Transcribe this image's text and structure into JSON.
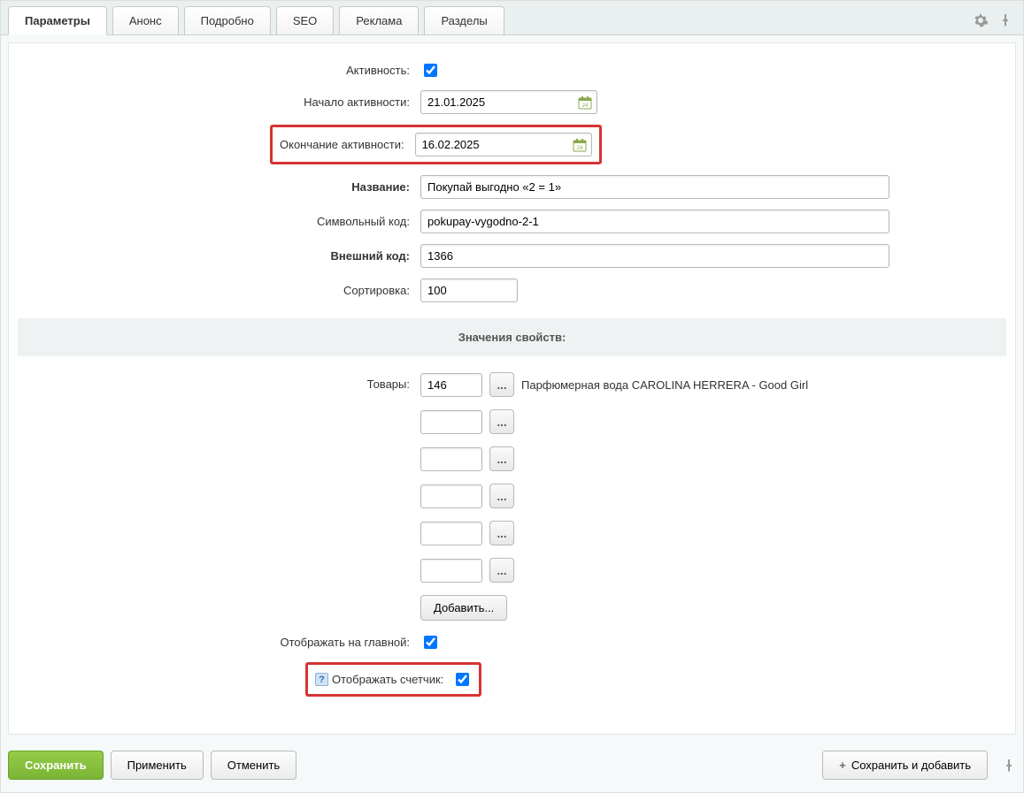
{
  "tabs": {
    "items": [
      "Параметры",
      "Анонс",
      "Подробно",
      "SEO",
      "Реклама",
      "Разделы"
    ],
    "activeIndex": 0
  },
  "form": {
    "activity_label": "Активность:",
    "activity_checked": true,
    "start_label": "Начало активности:",
    "start_value": "21.01.2025",
    "end_label": "Окончание активности:",
    "end_value": "16.02.2025",
    "name_label": "Название:",
    "name_value": "Покупай выгодно «2 = 1»",
    "code_label": "Символьный код:",
    "code_value": "pokupay-vygodno-2-1",
    "external_label": "Внешний код:",
    "external_value": "1366",
    "sort_label": "Сортировка:",
    "sort_value": "100"
  },
  "properties": {
    "section_title": "Значения свойств:",
    "goods_label": "Товары:",
    "goods": [
      {
        "id": "146",
        "text": "Парфюмерная вода CAROLINA HERRERA - Good Girl"
      },
      {
        "id": "",
        "text": ""
      },
      {
        "id": "",
        "text": ""
      },
      {
        "id": "",
        "text": ""
      },
      {
        "id": "",
        "text": ""
      },
      {
        "id": "",
        "text": ""
      }
    ],
    "add_button": "Добавить...",
    "show_main_label": "Отображать на главной:",
    "show_main_checked": true,
    "show_counter_label": "Отображать счетчик:",
    "show_counter_checked": true
  },
  "buttons": {
    "save": "Сохранить",
    "apply": "Применить",
    "cancel": "Отменить",
    "save_and_add": "Сохранить и добавить"
  }
}
